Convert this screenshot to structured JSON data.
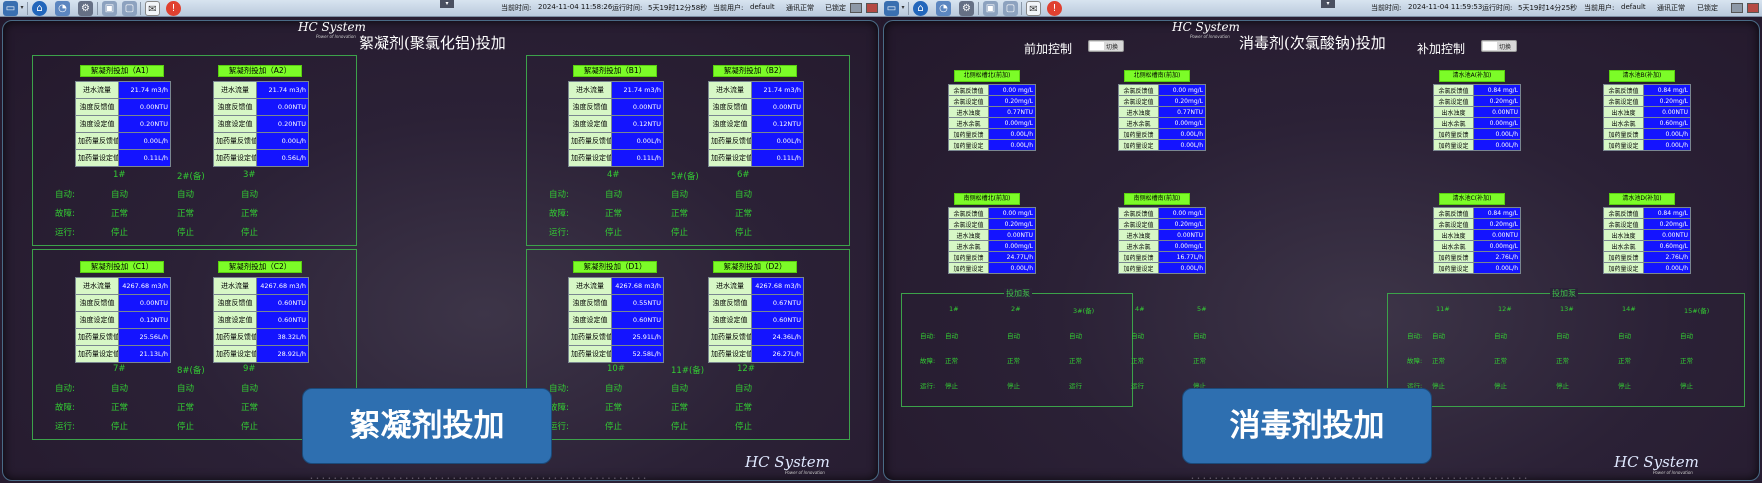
{
  "topbar_left": {
    "clock_label": "当前时间:",
    "clock": "2024-11-04 11:58:26",
    "runtime_label": "运行时间:",
    "runtime": "5天19时12分58秒",
    "user_label": "当前用户:",
    "user": "default",
    "comm": "通讯正常",
    "locked": "已锁定"
  },
  "topbar_right": {
    "clock_label": "当前时间:",
    "clock": "2024-11-04 11:59:53",
    "runtime_label": "运行时间:",
    "runtime": "5天19时14分25秒",
    "user_label": "当前用户:",
    "user": "default",
    "comm": "通讯正常",
    "locked": "已锁定"
  },
  "left": {
    "logo": "HC System",
    "logo_sub": "Power of Innovation",
    "logo_bottom": "HC System",
    "logo_bottom_sub": "Power of Innovation",
    "title": "絮凝剂(聚氯化铝)投加",
    "flow_label": "进水流量",
    "turb_fb_label": "浊度反馈值",
    "turb_set_label": "浊度设定值",
    "dose_fb_label": "加药量反馈值",
    "dose_set_label": "加药量设定值",
    "status": {
      "auto": "自动:",
      "fault": "故障:",
      "run": "运行:",
      "auto_v": "自动",
      "normal_v": "正常",
      "stop_v": "停止"
    },
    "boxes": [
      {
        "title": "絮凝剂投加（A1）",
        "vals": [
          "21.74 m3/h",
          "0.00NTU",
          "0.20NTU",
          "0.00L/h",
          "0.11L/h"
        ]
      },
      {
        "title": "絮凝剂投加（A2）",
        "vals": [
          "21.74 m3/h",
          "0.00NTU",
          "0.20NTU",
          "0.00L/h",
          "0.56L/h"
        ]
      },
      {
        "title": "絮凝剂投加（B1）",
        "vals": [
          "21.74 m3/h",
          "0.00NTU",
          "0.12NTU",
          "0.00L/h",
          "0.11L/h"
        ]
      },
      {
        "title": "絮凝剂投加（B2）",
        "vals": [
          "21.74 m3/h",
          "0.00NTU",
          "0.12NTU",
          "0.00L/h",
          "0.11L/h"
        ]
      },
      {
        "title": "絮凝剂投加（C1）",
        "vals": [
          "4267.68 m3/h",
          "0.00NTU",
          "0.12NTU",
          "25.56L/h",
          "21.13L/h"
        ]
      },
      {
        "title": "絮凝剂投加（C2）",
        "vals": [
          "4267.68 m3/h",
          "0.60NTU",
          "0.60NTU",
          "38.32L/h",
          "28.92L/h"
        ]
      },
      {
        "title": "絮凝剂投加（D1）",
        "vals": [
          "4267.68 m3/h",
          "0.55NTU",
          "0.60NTU",
          "25.91L/h",
          "52.58L/h"
        ]
      },
      {
        "title": "絮凝剂投加（D2）",
        "vals": [
          "4267.68 m3/h",
          "0.67NTU",
          "0.60NTU",
          "24.36L/h",
          "26.27L/h"
        ]
      }
    ],
    "pump_groups": [
      [
        "1#",
        "2#(备)",
        "3#"
      ],
      [
        "4#",
        "5#(备)",
        "6#"
      ],
      [
        "7#",
        "8#(备)",
        "9#"
      ],
      [
        "10#",
        "11#(备)",
        "12#"
      ]
    ],
    "button": "絮凝剂投加"
  },
  "right": {
    "logo": "HC System",
    "logo_sub": "Power of Innovation",
    "logo_bottom": "HC System",
    "logo_bottom_sub": "Power of Innovation",
    "title": "消毒剂(次氯酸钠)投加",
    "pre_label": "前加控制",
    "post_label": "补加控制",
    "toggle_label": "切换",
    "rows_pre": [
      "余氯反馈值",
      "余氯设定值",
      "进水浊度",
      "进水余氯",
      "加药量反馈",
      "加药量设定"
    ],
    "rows_post": [
      "余氯反馈值",
      "余氯设定值",
      "出水浊度",
      "出水余氯",
      "加药量反馈",
      "加药量设定"
    ],
    "boxes": [
      {
        "title": "北侧松槽北(前加)",
        "vals": [
          "0.00 mg/L",
          "0.20mg/L",
          "0.77NTU",
          "0.00mg/L",
          "0.00L/h",
          "0.00L/h"
        ]
      },
      {
        "title": "北侧松槽南(前加)",
        "vals": [
          "0.00 mg/L",
          "0.20mg/L",
          "0.77NTU",
          "0.00mg/L",
          "0.00L/h",
          "0.00L/h"
        ]
      },
      {
        "title": "清水池A(补加)",
        "vals": [
          "0.84 mg/L",
          "0.20mg/L",
          "0.00NTU",
          "0.00mg/L",
          "0.00L/h",
          "0.00L/h"
        ]
      },
      {
        "title": "清水池B(补加)",
        "vals": [
          "0.84 mg/L",
          "0.20mg/L",
          "0.00NTU",
          "0.60mg/L",
          "0.00L/h",
          "0.00L/h"
        ]
      },
      {
        "title": "南侧松槽北(前加)",
        "vals": [
          "0.00 mg/L",
          "0.20mg/L",
          "0.00NTU",
          "0.00mg/L",
          "24.77L/h",
          "0.00L/h"
        ]
      },
      {
        "title": "南侧松槽南(前加)",
        "vals": [
          "0.00 mg/L",
          "0.20mg/L",
          "0.00NTU",
          "0.00mg/L",
          "16.77L/h",
          "0.00L/h"
        ]
      },
      {
        "title": "清水池C(补加)",
        "vals": [
          "0.84 mg/L",
          "0.20mg/L",
          "0.00NTU",
          "0.00mg/L",
          "2.76L/h",
          "0.00L/h"
        ]
      },
      {
        "title": "清水池D(补加)",
        "vals": [
          "0.84 mg/L",
          "0.20mg/L",
          "0.00NTU",
          "0.60mg/L",
          "2.76L/h",
          "0.00L/h"
        ]
      }
    ],
    "legend": "投加泵",
    "pumps_pre": [
      "1#",
      "2#",
      "3#(备)",
      "4#",
      "5#"
    ],
    "pumps_post": [
      "11#",
      "12#",
      "13#",
      "14#",
      "15#(备)"
    ],
    "status_labels": {
      "auto": "自动:",
      "fault": "故障:",
      "run": "运行:"
    },
    "pre_auto": [
      "自动",
      "自动",
      "自动",
      "自动",
      "自动"
    ],
    "pre_fault": [
      "正常",
      "正常",
      "正常",
      "正常",
      "正常"
    ],
    "pre_run": [
      "停止",
      "停止",
      "运行",
      "运行",
      "停止"
    ],
    "post_auto": [
      "自动",
      "自动",
      "自动",
      "自动",
      "自动"
    ],
    "post_fault": [
      "正常",
      "正常",
      "正常",
      "正常",
      "正常"
    ],
    "post_run": [
      "停止",
      "停止",
      "停止",
      "停止",
      "停止"
    ],
    "button": "消毒剂投加"
  },
  "colors": {
    "value_cell": "#1414ff",
    "label_cell": "#d7f7c6",
    "box_title": "#7cfc28",
    "panel_border": "#3ca24a",
    "status_text": "#33cc33",
    "button": "#2e6fb0"
  },
  "icons": [
    "monitor-icon",
    "home-icon",
    "chart-icon",
    "gear-icon",
    "lock-icon",
    "unlock-icon",
    "message-icon",
    "alarm-icon"
  ]
}
